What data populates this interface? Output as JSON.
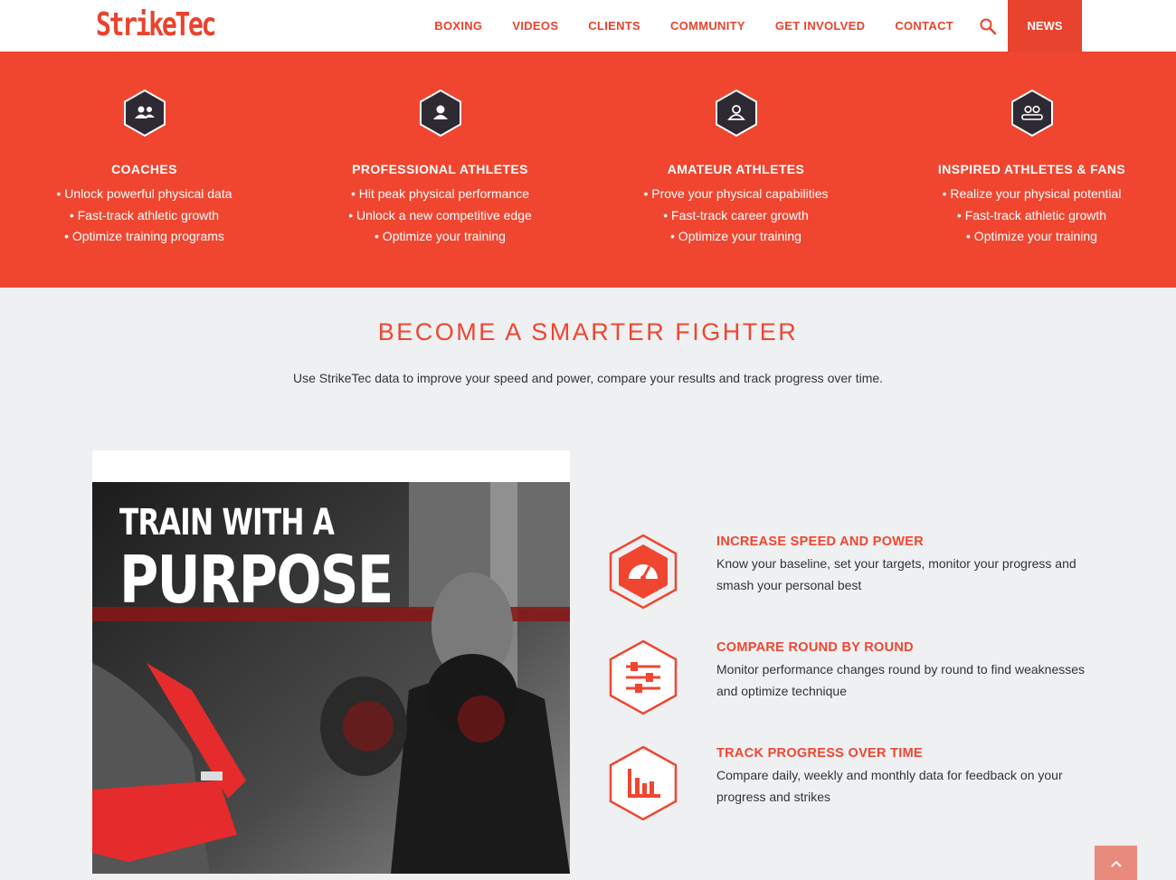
{
  "brand": {
    "logo_text": "StrikeTec",
    "accent": "#f04630"
  },
  "nav": {
    "items": [
      "BOXING",
      "VIDEOS",
      "CLIENTS",
      "COMMUNITY",
      "GET INVOLVED",
      "CONTACT"
    ],
    "search_icon": "search-icon",
    "news": "NEWS"
  },
  "audiences": [
    {
      "icon": "group-icon",
      "title": "COACHES",
      "lines": [
        "• Unlock powerful physical data",
        "• Fast-track athletic growth",
        "• Optimize training programs"
      ]
    },
    {
      "icon": "person-icon",
      "title": "PROFESSIONAL ATHLETES",
      "lines": [
        "• Hit peak physical performance",
        "• Unlock a new competitive edge",
        "• Optimize your training"
      ]
    },
    {
      "icon": "user-outline-icon",
      "title": "AMATEUR ATHLETES",
      "lines": [
        "• Prove your physical capabilities",
        "• Fast-track career growth",
        "• Optimize your training"
      ]
    },
    {
      "icon": "fans-icon",
      "title": "INSPIRED ATHLETES & FANS",
      "lines": [
        "• Realize your physical potential",
        "• Fast-track athletic growth",
        "• Optimize your training"
      ]
    }
  ],
  "section": {
    "title": "BECOME A SMARTER FIGHTER",
    "subtitle": "Use StrikeTec data to improve your speed and power, compare your results and track progress over time."
  },
  "promo": {
    "line1": "TRAIN WITH A",
    "line2": "PURPOSE"
  },
  "features": [
    {
      "icon": "speedometer-icon",
      "title": "INCREASE SPEED AND POWER",
      "desc": "Know your baseline, set your targets, monitor your progress and smash your personal best"
    },
    {
      "icon": "sliders-icon",
      "title": "COMPARE ROUND BY ROUND",
      "desc": "Monitor performance changes round by round to find weaknesses and optimize technique"
    },
    {
      "icon": "bar-chart-icon",
      "title": "TRACK PROGRESS OVER TIME",
      "desc": "Compare daily, weekly and monthly data for feedback on your progress and strikes"
    }
  ],
  "scroll_top_icon": "chevron-up-icon"
}
